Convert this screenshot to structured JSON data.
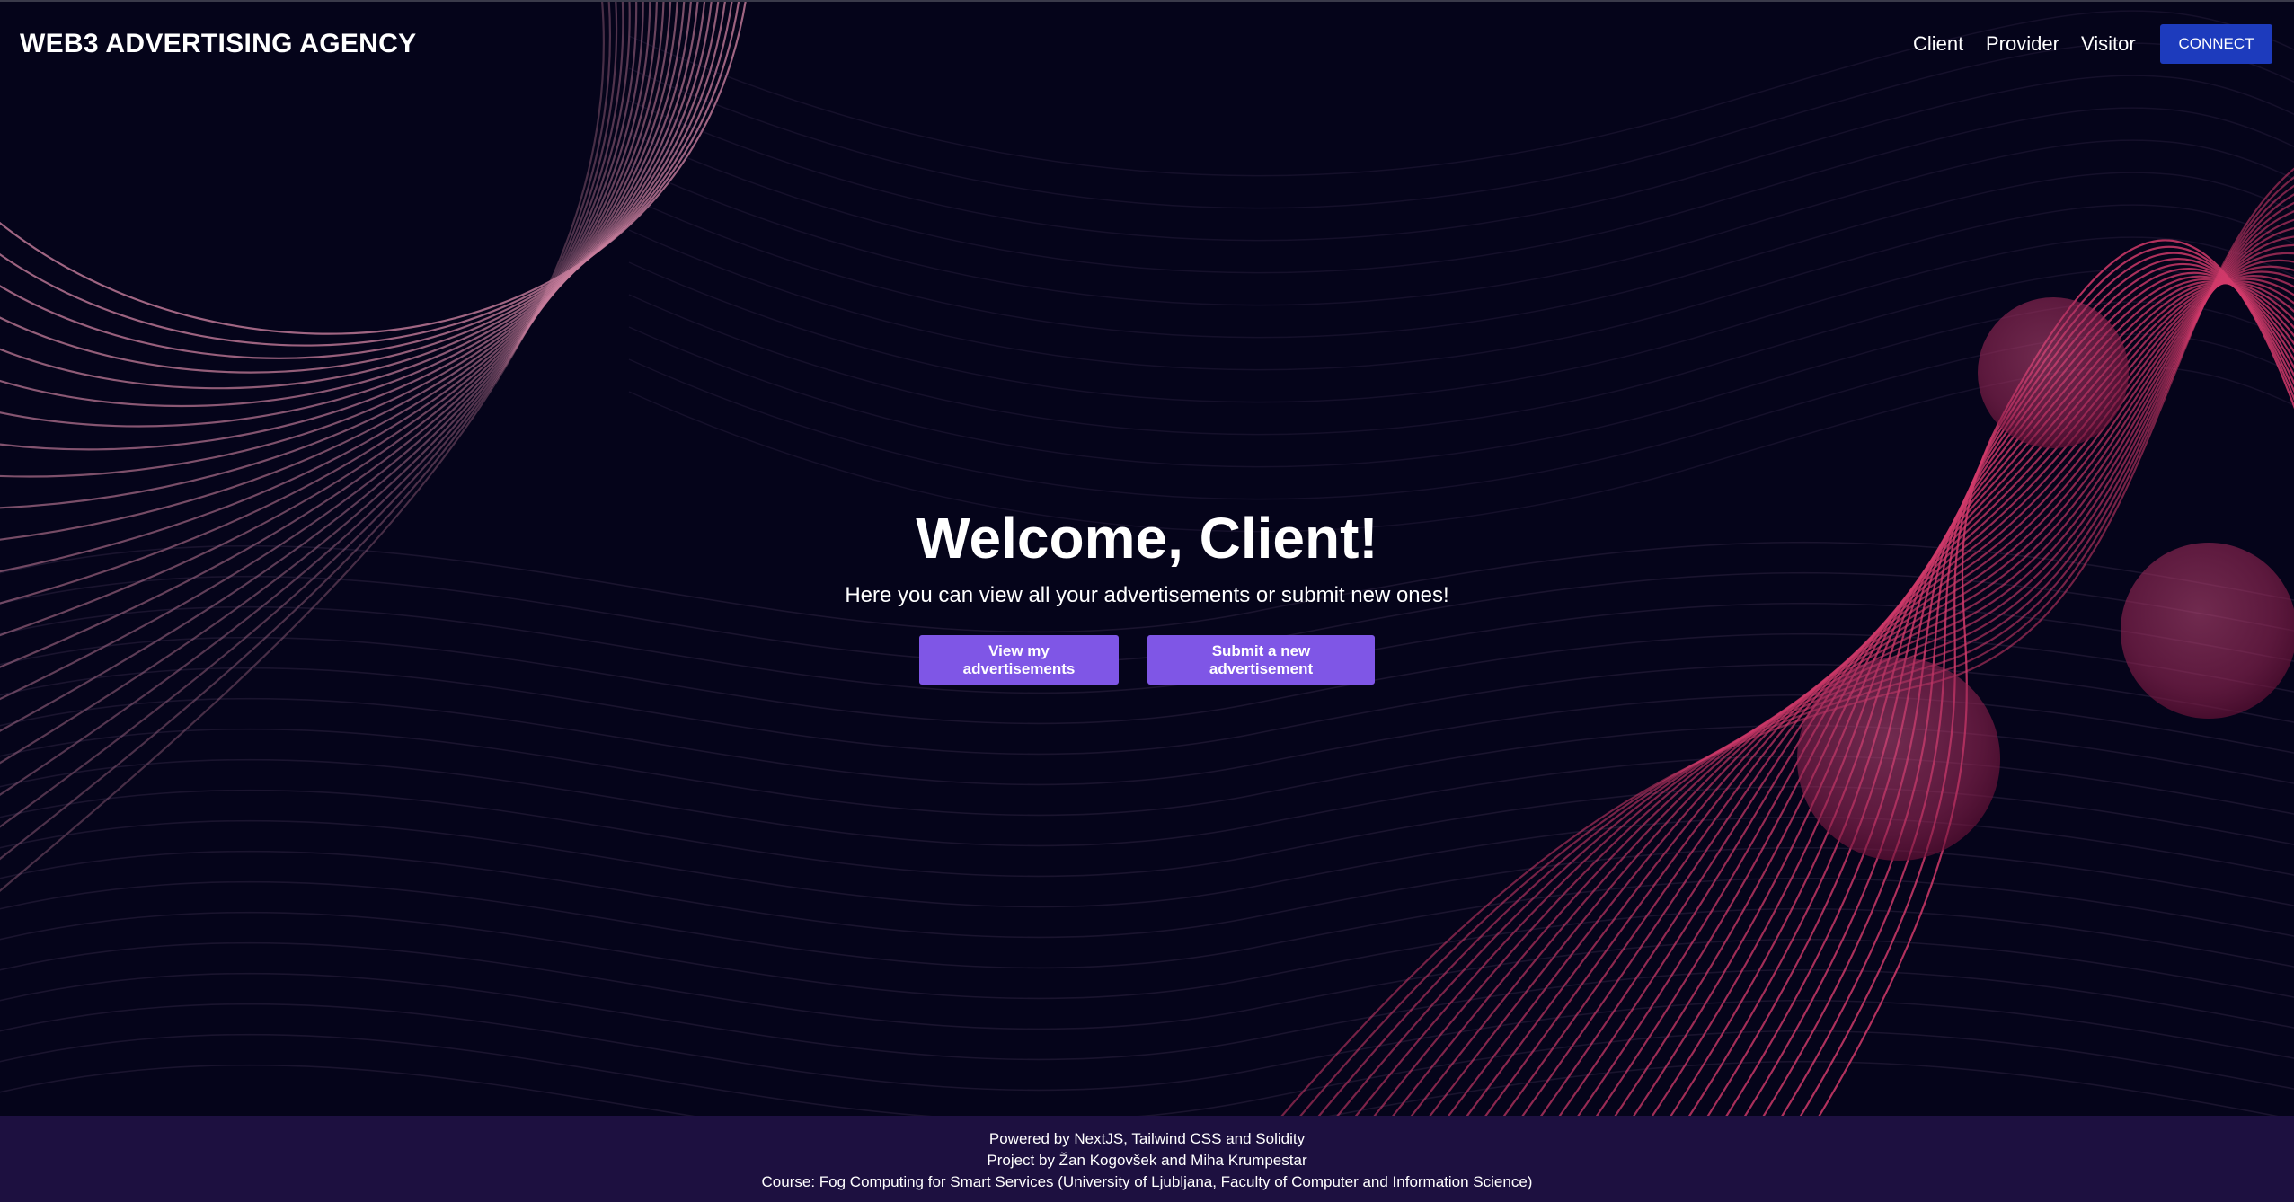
{
  "navbar": {
    "brand": "WEB3 ADVERTISING AGENCY",
    "links": [
      "Client",
      "Provider",
      "Visitor"
    ],
    "connect_label": "CONNECT"
  },
  "hero": {
    "title": "Welcome, Client!",
    "subtitle": "Here you can view all your advertisements or submit new ones!",
    "view_button": "View my advertisements",
    "submit_button": "Submit a new advertisement"
  },
  "footer": {
    "line1": "Powered by NextJS, Tailwind CSS and Solidity",
    "line2": "Project by Žan Kogovšek and Miha Krumpestar",
    "line3": "Course: Fog Computing for Smart Services (University of Ljubljana, Faculty of Computer and Information Science)"
  },
  "colors": {
    "background": "#05041a",
    "wave_left": "#c77e9c",
    "wave_right": "#d13a6a",
    "hero_button": "#7f56e6",
    "connect_button": "#1d3bbd",
    "footer_bg": "#1d1040"
  }
}
